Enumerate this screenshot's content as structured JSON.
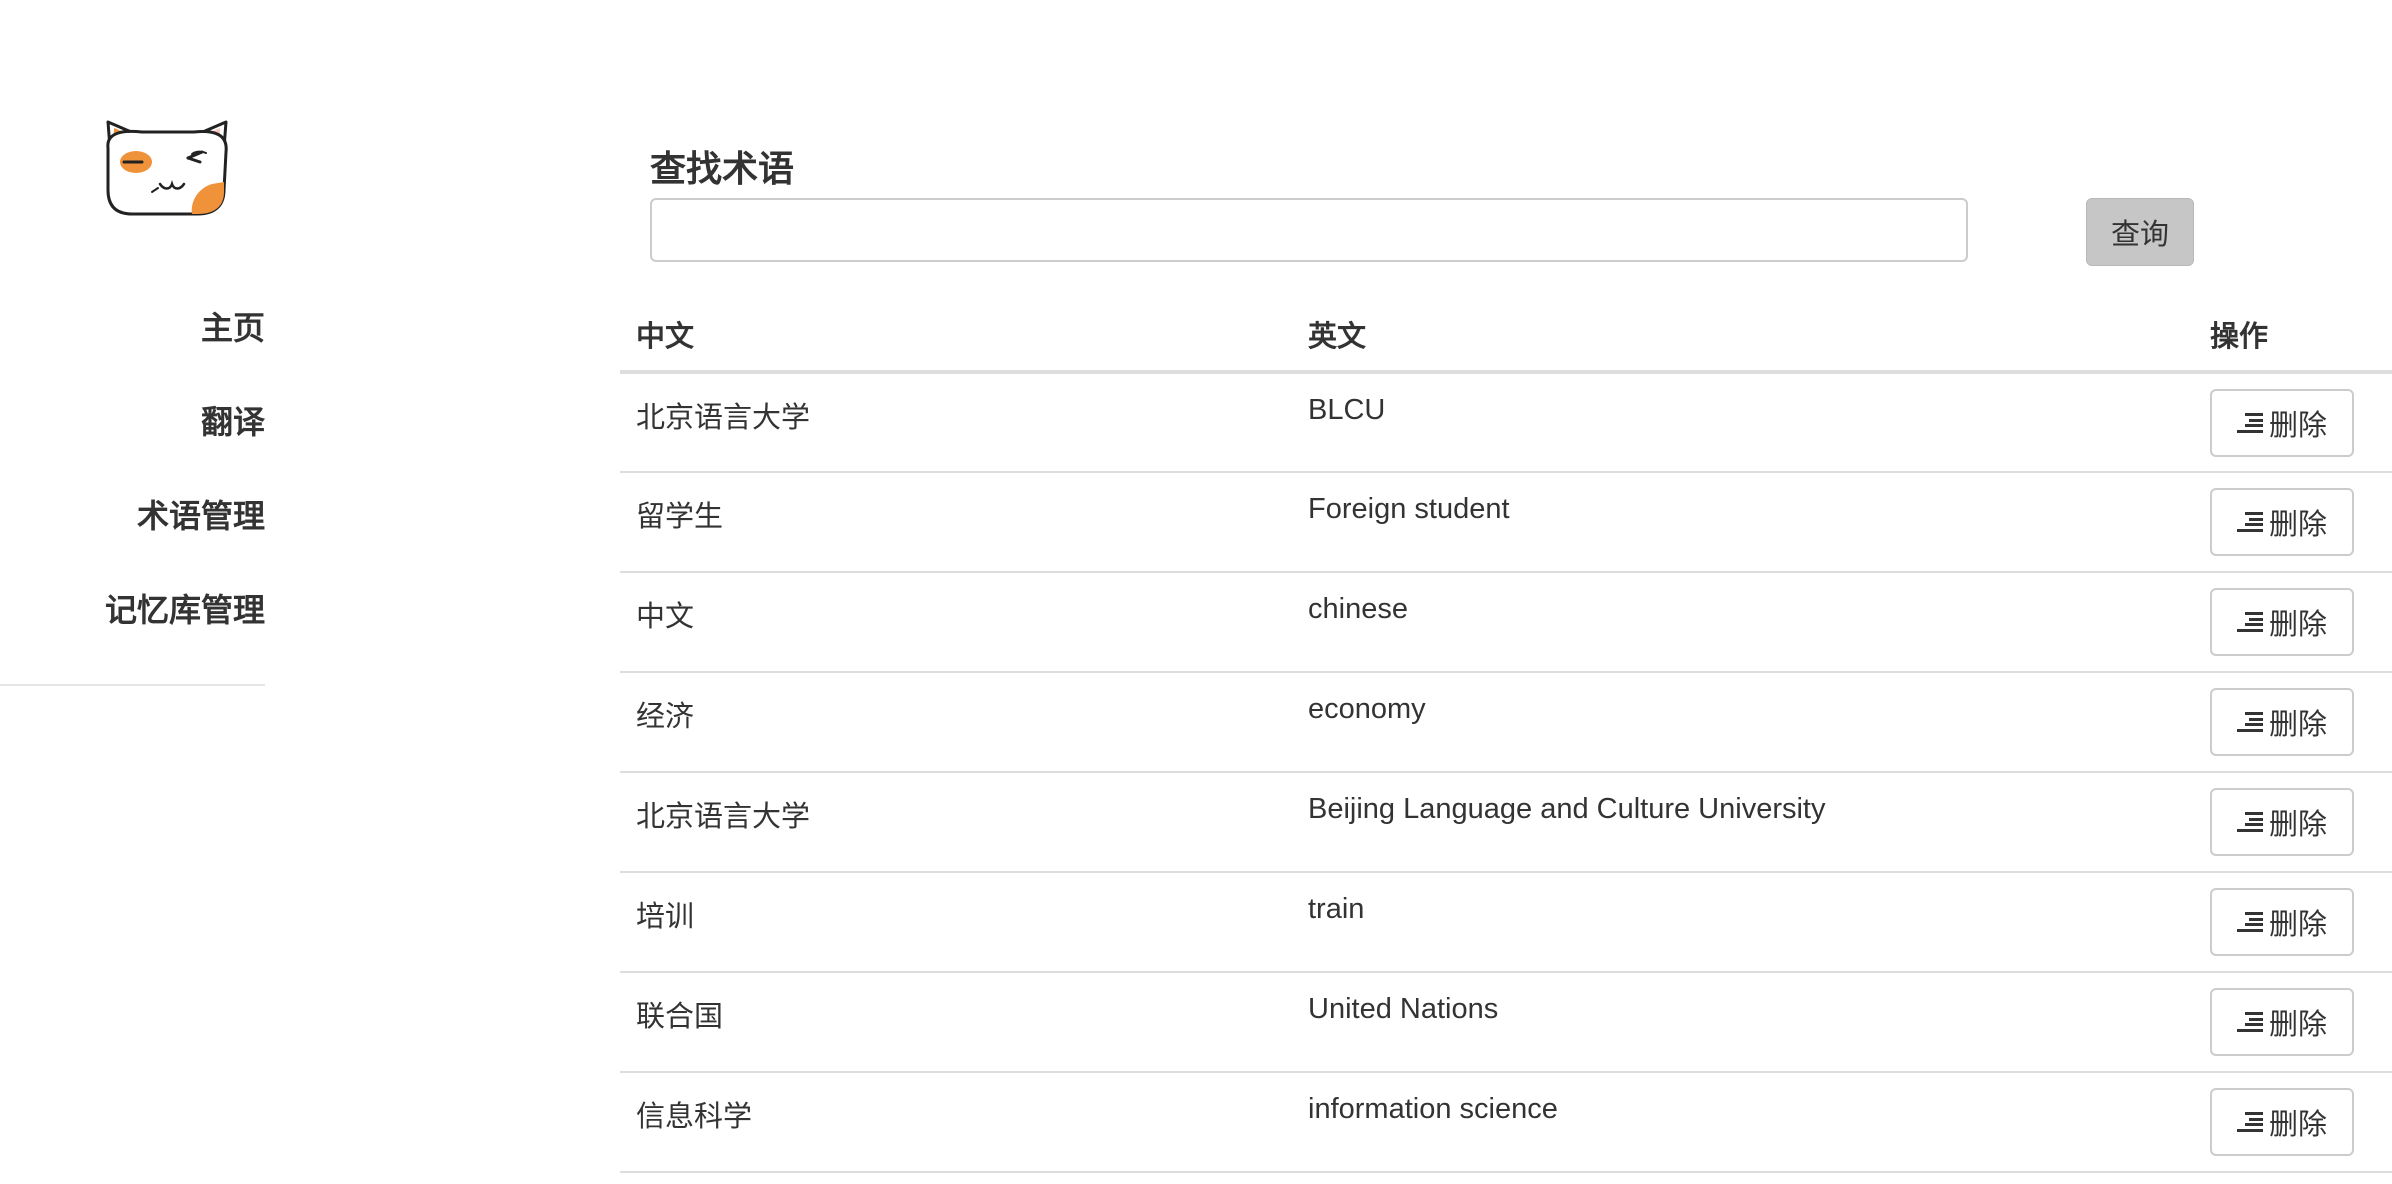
{
  "sidebar": {
    "logo": "cat-face-logo",
    "items": [
      {
        "label": "主页"
      },
      {
        "label": "翻译"
      },
      {
        "label": "术语管理"
      },
      {
        "label": "记忆库管理"
      }
    ]
  },
  "search": {
    "title": "查找术语",
    "value": "",
    "placeholder": "",
    "button_label": "查询"
  },
  "table": {
    "headers": {
      "zh": "中文",
      "en": "英文",
      "op": "操作"
    },
    "delete_label": "删除",
    "delete_icon": "align-right-lines-icon",
    "rows": [
      {
        "zh": "北京语言大学",
        "en": "BLCU"
      },
      {
        "zh": "留学生",
        "en": "Foreign student"
      },
      {
        "zh": "中文",
        "en": "chinese"
      },
      {
        "zh": "经济",
        "en": "economy"
      },
      {
        "zh": "北京语言大学",
        "en": "Beijing Language and Culture University"
      },
      {
        "zh": "培训",
        "en": "train"
      },
      {
        "zh": "联合国",
        "en": "United Nations"
      },
      {
        "zh": "信息科学",
        "en": "information science"
      }
    ]
  },
  "colors": {
    "text": "#333333",
    "search_button_bg": "#c6c6c6",
    "logo_accent": "#f0923a",
    "border": "#dddddd"
  }
}
